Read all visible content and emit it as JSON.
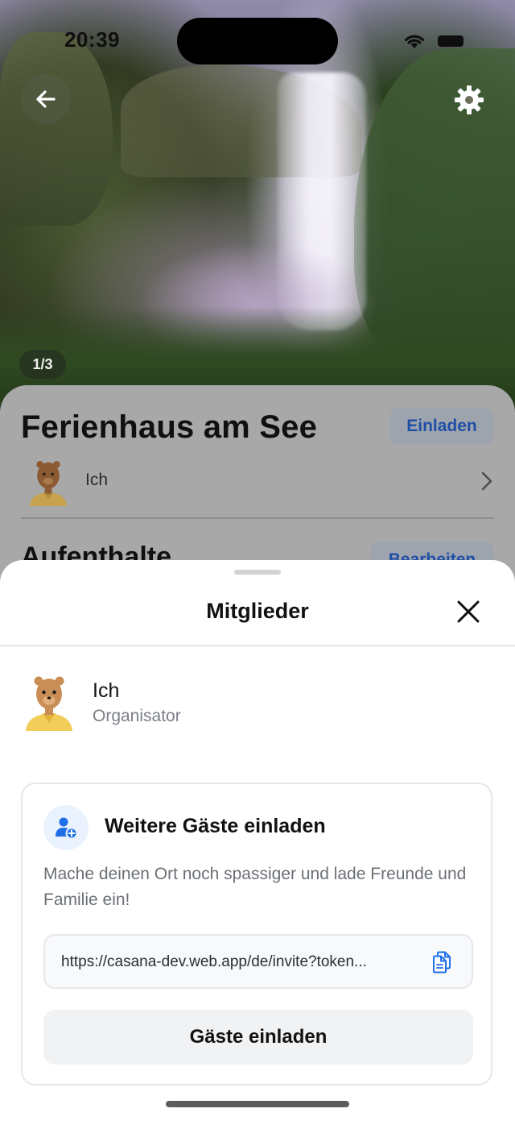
{
  "status_bar": {
    "time": "20:39"
  },
  "hero": {
    "image_counter": "1/3",
    "back_icon": "arrow-left-icon",
    "settings_icon": "gear-icon"
  },
  "place": {
    "title": "Ferienhaus am See",
    "invite_label": "Einladen",
    "owner_name": "Ich",
    "section_title": "Aufenthalte",
    "edit_label": "Bearbeiten"
  },
  "sheet": {
    "title": "Mitglieder",
    "members": [
      {
        "name": "Ich",
        "role": "Organisator"
      }
    ],
    "invite_card": {
      "title": "Weitere Gäste einladen",
      "description": "Mache deinen Ort noch spassiger und lade Freunde und Familie ein!",
      "link": "https://casana-dev.web.app/de/invite?token...",
      "button_label": "Gäste einladen"
    }
  },
  "colors": {
    "accent": "#1f6fe8",
    "sheet_bg": "#ffffff",
    "muted_text": "#7b7f86"
  }
}
